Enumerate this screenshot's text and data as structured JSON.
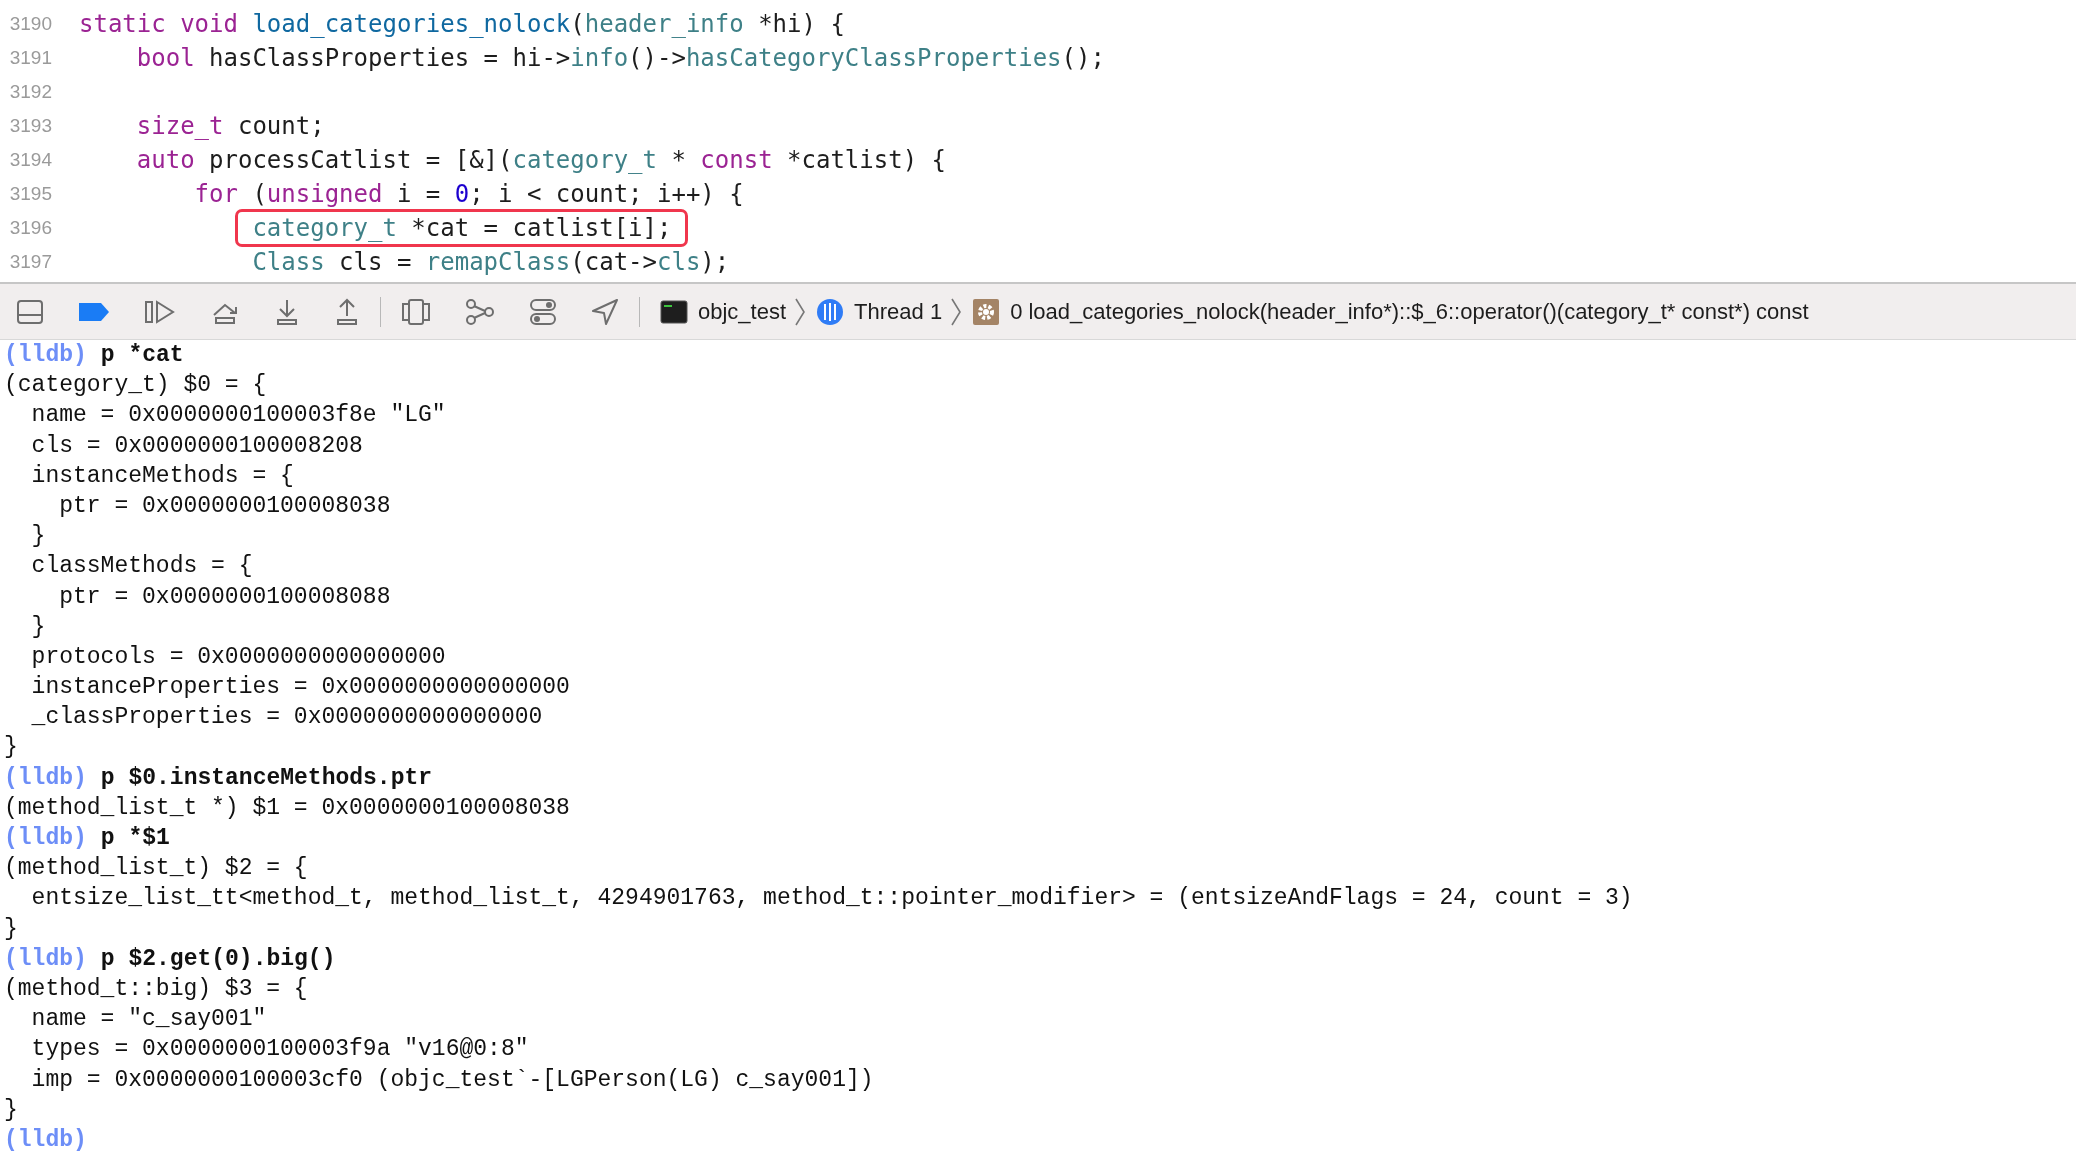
{
  "editor": {
    "lines": [
      {
        "number": "3190",
        "tokens": [
          {
            "kind": "kw",
            "text": "static void "
          },
          {
            "kind": "fn",
            "text": "load_categories_nolock"
          },
          {
            "kind": "plain",
            "text": "("
          },
          {
            "kind": "type",
            "text": "header_info"
          },
          {
            "kind": "plain",
            "text": " *hi) {"
          }
        ],
        "children": [
          {
            "number": "3191",
            "tokens": [
              {
                "kind": "kw",
                "text": "bool"
              },
              {
                "kind": "plain",
                "text": " hasClassProperties = hi->"
              },
              {
                "kind": "type",
                "text": "info"
              },
              {
                "kind": "plain",
                "text": "()->"
              },
              {
                "kind": "type",
                "text": "hasCategoryClassProperties"
              },
              {
                "kind": "plain",
                "text": "();"
              }
            ]
          },
          {
            "number": "3192"
          },
          {
            "number": "3193",
            "tokens": [
              {
                "kind": "kw",
                "text": "size_t"
              },
              {
                "kind": "plain",
                "text": " count;"
              }
            ]
          },
          {
            "number": "3194",
            "tokens": [
              {
                "kind": "kw",
                "text": "auto"
              },
              {
                "kind": "plain",
                "text": " processCatlist = [&]("
              },
              {
                "kind": "type",
                "text": "category_t"
              },
              {
                "kind": "plain",
                "text": " * "
              },
              {
                "kind": "kw",
                "text": "const"
              },
              {
                "kind": "plain",
                "text": " *catlist) {"
              }
            ],
            "children": [
              {
                "number": "3195",
                "tokens": [
                  {
                    "kind": "kw",
                    "text": "for"
                  },
                  {
                    "kind": "plain",
                    "text": " ("
                  },
                  {
                    "kind": "kw",
                    "text": "unsigned"
                  },
                  {
                    "kind": "plain",
                    "text": " i = "
                  },
                  {
                    "kind": "num",
                    "text": "0"
                  },
                  {
                    "kind": "plain",
                    "text": "; i < count; i++) {"
                  }
                ],
                "children": [
                  {
                    "number": "3196",
                    "highlighted": true,
                    "tokens": [
                      {
                        "kind": "type",
                        "text": "category_t"
                      },
                      {
                        "kind": "plain",
                        "text": " *cat = catlist[i];"
                      }
                    ]
                  },
                  {
                    "number": "3197",
                    "tokens": [
                      {
                        "kind": "type",
                        "text": "Class"
                      },
                      {
                        "kind": "plain",
                        "text": " cls = "
                      },
                      {
                        "kind": "type",
                        "text": "remapClass"
                      },
                      {
                        "kind": "plain",
                        "text": "(cat->"
                      },
                      {
                        "kind": "type",
                        "text": "cls"
                      },
                      {
                        "kind": "plain",
                        "text": ");"
                      }
                    ]
                  }
                ]
              }
            ]
          }
        ]
      }
    ]
  },
  "debug_bar": {
    "breakpoints_active": true,
    "process": "objc_test",
    "thread": "Thread 1",
    "frame": "0 load_categories_nolock(header_info*)::$_6::operator()(category_t* const*) const"
  },
  "console": {
    "lines": [
      {
        "kind": "prompt",
        "prompt": "(lldb)",
        "command": "p *cat"
      },
      {
        "kind": "output",
        "text": "(category_t) $0 = {"
      },
      {
        "kind": "output",
        "text": "  name = 0x0000000100003f8e \"LG\""
      },
      {
        "kind": "output",
        "text": "  cls = 0x0000000100008208"
      },
      {
        "kind": "output",
        "text": "  instanceMethods = {"
      },
      {
        "kind": "output",
        "text": "    ptr = 0x0000000100008038"
      },
      {
        "kind": "output",
        "text": "  }"
      },
      {
        "kind": "output",
        "text": "  classMethods = {"
      },
      {
        "kind": "output",
        "text": "    ptr = 0x0000000100008088"
      },
      {
        "kind": "output",
        "text": "  }"
      },
      {
        "kind": "output",
        "text": "  protocols = 0x0000000000000000"
      },
      {
        "kind": "output",
        "text": "  instanceProperties = 0x0000000000000000"
      },
      {
        "kind": "output",
        "text": "  _classProperties = 0x0000000000000000"
      },
      {
        "kind": "output",
        "text": "}"
      },
      {
        "kind": "prompt",
        "prompt": "(lldb)",
        "command": "p $0.instanceMethods.ptr"
      },
      {
        "kind": "output",
        "text": "(method_list_t *) $1 = 0x0000000100008038"
      },
      {
        "kind": "prompt",
        "prompt": "(lldb)",
        "command": "p *$1"
      },
      {
        "kind": "output",
        "text": "(method_list_t) $2 = {"
      },
      {
        "kind": "output",
        "text": "  entsize_list_tt<method_t, method_list_t, 4294901763, method_t::pointer_modifier> = (entsizeAndFlags = 24, count = 3)"
      },
      {
        "kind": "output",
        "text": "}"
      },
      {
        "kind": "prompt",
        "prompt": "(lldb)",
        "command": "p $2.get(0).big()"
      },
      {
        "kind": "output",
        "text": "(method_t::big) $3 = {"
      },
      {
        "kind": "output",
        "text": "  name = \"c_say001\""
      },
      {
        "kind": "output",
        "text": "  types = 0x0000000100003f9a \"v16@0:8\""
      },
      {
        "kind": "output",
        "text": "  imp = 0x0000000100003cf0 (objc_test`-[LGPerson(LG) c_say001])"
      },
      {
        "kind": "output",
        "text": "}"
      },
      {
        "kind": "prompt",
        "prompt": "(lldb)"
      }
    ]
  }
}
